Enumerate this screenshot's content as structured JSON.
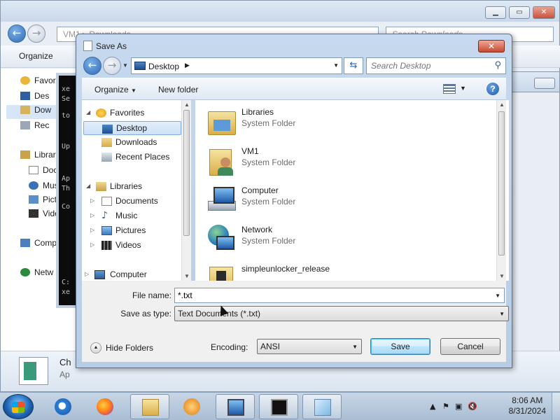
{
  "background_window": {
    "breadcrumb": [
      "VM1",
      "Downloads"
    ],
    "search_placeholder": "Search Downloads",
    "organize": "Organize",
    "nav_items": [
      "Favor",
      "Des",
      "Dow",
      "Rec",
      "Librar",
      "Doc",
      "Mus",
      "Pict",
      "Vide",
      "Comp",
      "Netw"
    ],
    "details_name": "Ch",
    "details_sub": "Ap"
  },
  "console_lines": [
    "xe",
    "Se",
    "to",
    "Up",
    "Ap",
    "Th",
    "Co",
    "C:",
    "xe"
  ],
  "dialog": {
    "title": "Save As",
    "close_glyph": "✕",
    "address": "Desktop",
    "search_placeholder": "Search Desktop",
    "organize_label": "Organize",
    "new_folder_label": "New folder",
    "help_glyph": "?",
    "tree": {
      "favorites": "Favorites",
      "desktop": "Desktop",
      "downloads": "Downloads",
      "recent_places": "Recent Places",
      "libraries": "Libraries",
      "documents": "Documents",
      "music": "Music",
      "pictures": "Pictures",
      "videos": "Videos",
      "computer": "Computer"
    },
    "files": [
      {
        "name": "Libraries",
        "type": "System Folder",
        "icon": "libraries-icon"
      },
      {
        "name": "VM1",
        "type": "System Folder",
        "icon": "user-folder-icon"
      },
      {
        "name": "Computer",
        "type": "System Folder",
        "icon": "computer-icon"
      },
      {
        "name": "Network",
        "type": "System Folder",
        "icon": "network-icon"
      },
      {
        "name": "simpleunlocker_release",
        "type": "",
        "icon": "folder-icon"
      }
    ],
    "file_name_label": "File name:",
    "file_name_value": "*.txt",
    "save_as_type_label": "Save as type:",
    "save_as_type_value": "Text Documents (*.txt)",
    "hide_folders_label": "Hide Folders",
    "encoding_label": "Encoding:",
    "encoding_value": "ANSI",
    "save_label": "Save",
    "cancel_label": "Cancel"
  },
  "taskbar": {
    "time": "8:06 AM",
    "date": "8/31/2024"
  }
}
